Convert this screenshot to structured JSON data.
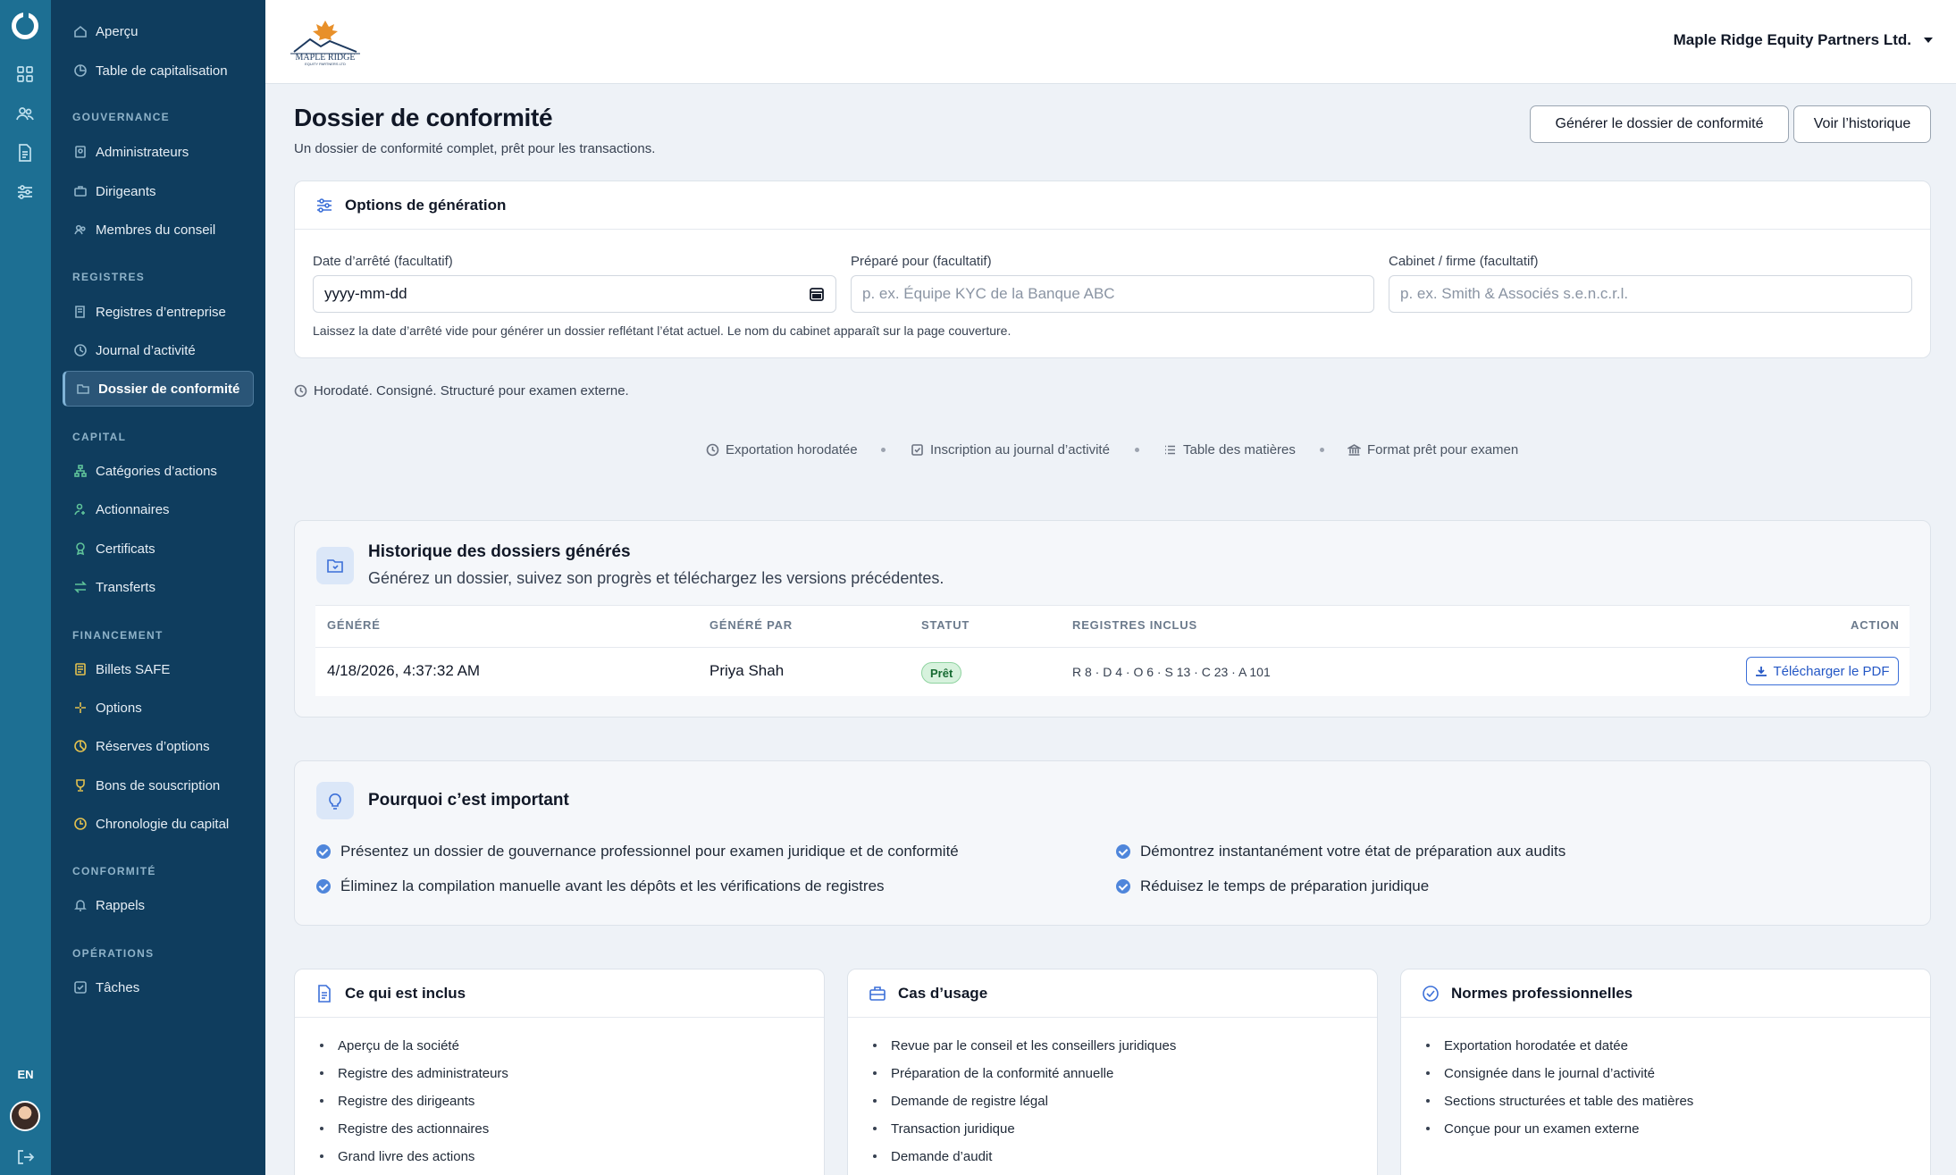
{
  "app": {
    "org_name": "Maple Ridge Equity Partners Ltd.",
    "language": "EN",
    "brand_name": "MAPLE RIDGE",
    "brand_tag": "EQUITY PARTNERS LTD"
  },
  "sidebar": {
    "top": [
      {
        "label": "Aperçu",
        "icon": "home-icon"
      },
      {
        "label": "Table de capitalisation",
        "icon": "pie-chart-icon"
      }
    ],
    "sections": {
      "gouvernance": "GOUVERNANCE",
      "registres": "REGISTRES",
      "capital": "CAPITAL",
      "financement": "FINANCEMENT",
      "conformite": "CONFORMITÉ",
      "operations": "OPÉRATIONS"
    },
    "items": {
      "administrateurs": "Administrateurs",
      "dirigeants": "Dirigeants",
      "membres": "Membres du conseil",
      "registres_entreprise": "Registres d’entreprise",
      "journal": "Journal d’activité",
      "dossier": "Dossier de conformité",
      "categories": "Catégories d’actions",
      "actionnaires": "Actionnaires",
      "certificats": "Certificats",
      "transferts": "Transferts",
      "safe": "Billets SAFE",
      "options": "Options",
      "reserves": "Réserves d’options",
      "bons": "Bons de souscription",
      "chronologie": "Chronologie du capital",
      "rappels": "Rappels",
      "taches": "Tâches"
    }
  },
  "page": {
    "title": "Dossier de conformité",
    "subtitle": "Un dossier de conformité complet, prêt pour les transactions.",
    "generate_button": "Générer le dossier de conformité",
    "history_button": "Voir l’historique"
  },
  "options": {
    "title": "Options de génération",
    "date_label": "Date d’arrêté (facultatif)",
    "date_placeholder": "yyyy-mm-dd",
    "prepared_label": "Préparé pour (facultatif)",
    "prepared_placeholder": "p. ex. Équipe KYC de la Banque ABC",
    "firm_label": "Cabinet / firme (facultatif)",
    "firm_placeholder": "p. ex. Smith & Associés s.e.n.c.r.l.",
    "hint": "Laissez la date d’arrêté vide pour générer un dossier reflétant l’état actuel. Le nom du cabinet apparaît sur la page couverture."
  },
  "stamp_text": "Horodaté. Consigné. Structuré pour examen externe.",
  "features": [
    "Exportation horodatée",
    "Inscription au journal d’activité",
    "Table des matières",
    "Format prêt pour examen"
  ],
  "history": {
    "title": "Historique des dossiers générés",
    "subtitle": "Générez un dossier, suivez son progrès et téléchargez les versions précédentes.",
    "columns": [
      "GÉNÉRÉ",
      "GÉNÉRÉ PAR",
      "STATUT",
      "REGISTRES INCLUS",
      "ACTION"
    ],
    "rows": [
      {
        "generated": "4/18/2026, 4:37:32 AM",
        "by": "Priya Shah",
        "status": "Prêt",
        "registers": "R 8 · D 4 · O 6 · S 13 · C 23 · A 101",
        "action": "Télécharger le PDF"
      }
    ]
  },
  "why": {
    "title": "Pourquoi c’est important",
    "points": [
      "Présentez un dossier de gouvernance professionnel pour examen juridique et de conformité",
      "Démontrez instantanément votre état de préparation aux audits",
      "Éliminez la compilation manuelle avant les dépôts et les vérifications de registres",
      "Réduisez le temps de préparation juridique"
    ]
  },
  "included": {
    "title": "Ce qui est inclus",
    "items": [
      "Aperçu de la société",
      "Registre des administrateurs",
      "Registre des dirigeants",
      "Registre des actionnaires",
      "Grand livre des actions"
    ]
  },
  "usecases": {
    "title": "Cas d’usage",
    "items": [
      "Revue par le conseil et les conseillers juridiques",
      "Préparation de la conformité annuelle",
      "Demande de registre légal",
      "Transaction juridique",
      "Demande d’audit"
    ]
  },
  "standards": {
    "title": "Normes professionnelles",
    "items": [
      "Exportation horodatée et datée",
      "Consignée dans le journal d’activité",
      "Sections structurées et table des matières",
      "Conçue pour un examen externe"
    ]
  },
  "colors": {
    "rail": "#1d6f93",
    "sidebar": "#0f3d5e",
    "accent": "#3b6fd8",
    "success": "#176b32"
  }
}
